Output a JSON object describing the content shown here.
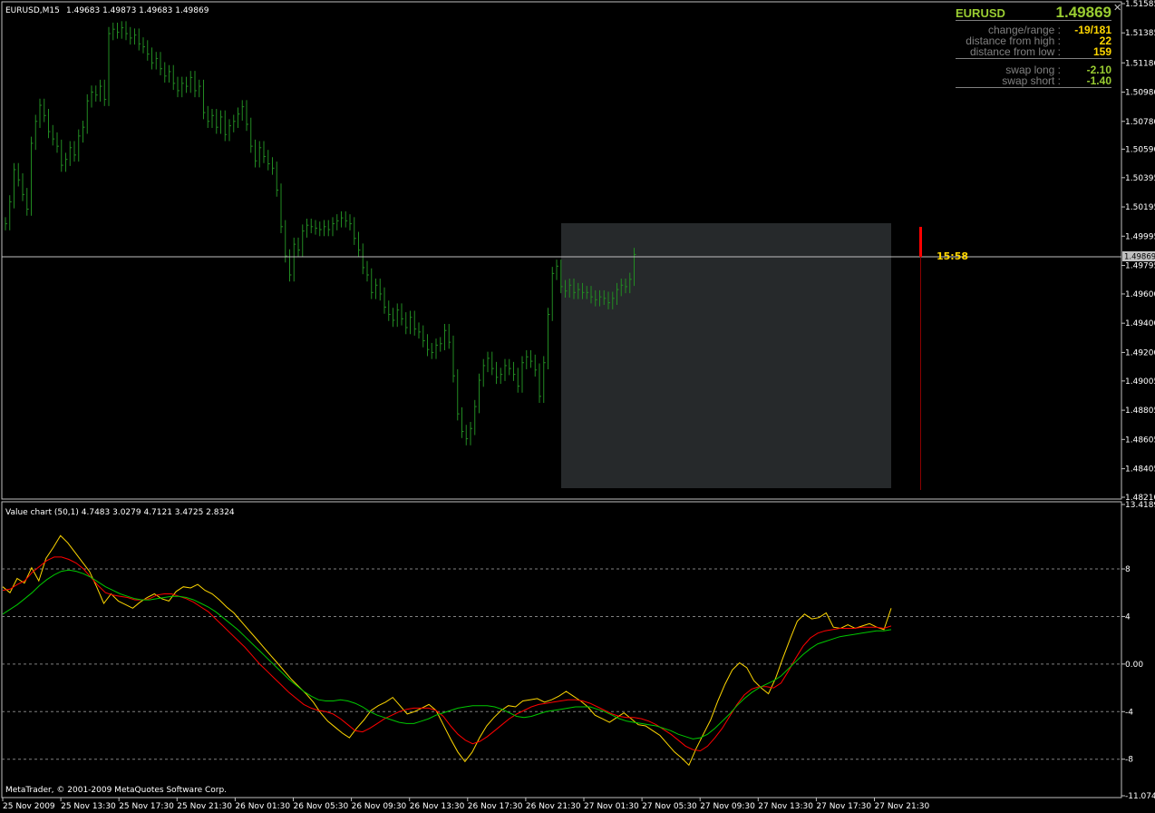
{
  "header": {
    "symbol_timeframe": "EURUSD,M15",
    "ohlc": "1.49683 1.49873 1.49683 1.49869"
  },
  "info_panel": {
    "symbol": "EURUSD",
    "price": "1.49869",
    "rows": [
      {
        "label": "change/range :",
        "value": "-19/181",
        "color": "#ffd700"
      },
      {
        "label": "distance from high :",
        "value": "22",
        "color": "#ffd700"
      },
      {
        "label": "distance from low :",
        "value": "159",
        "color": "#ffd700"
      },
      {
        "label": "swap long :",
        "value": "-2.10",
        "color": "#9acd32"
      },
      {
        "label": "swap short :",
        "value": "-1.40",
        "color": "#9acd32"
      }
    ]
  },
  "timer": "15:58",
  "indicator": {
    "title": "Value chart (50,1) 4.7483 3.0279 4.7121 3.4725 2.8324"
  },
  "copyright": "MetaTrader, © 2001-2009 MetaQuotes Software Corp.",
  "price_axis": {
    "labels": [
      "1.51585",
      "1.51385",
      "1.51180",
      "1.50980",
      "1.50780",
      "1.50590",
      "1.50395",
      "1.50195",
      "1.49995",
      "1.49869",
      "1.49795",
      "1.49600",
      "1.49400",
      "1.49200",
      "1.49005",
      "1.48805",
      "1.48605",
      "1.48405",
      "1.48210"
    ],
    "current": "1.49869"
  },
  "indicator_axis": {
    "labels": [
      "13.4189",
      "8",
      "4",
      "0.00",
      "-4",
      "-8",
      "-11.0748"
    ]
  },
  "time_axis": {
    "labels": [
      "25 Nov 2009",
      "25 Nov 13:30",
      "25 Nov 17:30",
      "25 Nov 21:30",
      "26 Nov 01:30",
      "26 Nov 05:30",
      "26 Nov 09:30",
      "26 Nov 13:30",
      "26 Nov 17:30",
      "26 Nov 21:30",
      "27 Nov 01:30",
      "27 Nov 05:30",
      "27 Nov 09:30",
      "27 Nov 13:30",
      "27 Nov 17:30",
      "27 Nov 21:30"
    ]
  },
  "colors": {
    "bars": "#228b22",
    "value_line": "#ffd700",
    "ma_fast": "#ff0000",
    "ma_slow": "#00c800",
    "grid": "#808080",
    "shade": "#26292b",
    "current_line": "#c0c0c0",
    "timer": "#ffd700",
    "marker": "#ff0000"
  },
  "chart_data": {
    "type": "line",
    "price": {
      "ylim": [
        1.4821,
        1.51585
      ],
      "current": 1.49869,
      "close": [
        1.5008,
        1.5023,
        1.5045,
        1.5038,
        1.5028,
        1.5018,
        1.5063,
        1.5078,
        1.5089,
        1.5082,
        1.5071,
        1.5066,
        1.5061,
        1.5048,
        1.5052,
        1.506,
        1.5055,
        1.5068,
        1.5074,
        1.5092,
        1.5098,
        1.5096,
        1.5102,
        1.5093,
        1.5138,
        1.5141,
        1.5139,
        1.5142,
        1.5138,
        1.5135,
        1.5137,
        1.5131,
        1.5129,
        1.5124,
        1.5118,
        1.5121,
        1.5114,
        1.5109,
        1.5112,
        1.5104,
        1.5099,
        1.5104,
        1.5102,
        1.5108,
        1.5099,
        1.5102,
        1.5084,
        1.5078,
        1.5082,
        1.5074,
        1.5081,
        1.5069,
        1.5075,
        1.5078,
        1.5083,
        1.5088,
        1.5076,
        1.5061,
        1.5051,
        1.506,
        1.5054,
        1.5049,
        1.5046,
        1.5031,
        1.5006,
        1.4986,
        1.4973,
        1.4994,
        1.499,
        1.5003,
        1.5007,
        1.5006,
        1.5005,
        1.5004,
        1.5006,
        1.5004,
        1.5008,
        1.501,
        1.5012,
        1.501,
        1.5008,
        1.4998,
        1.499,
        1.4978,
        1.4973,
        1.4961,
        1.4966,
        1.496,
        1.4951,
        1.4946,
        1.4942,
        1.4949,
        1.4943,
        1.4937,
        1.4944,
        1.4936,
        1.4934,
        1.4928,
        1.4922,
        1.492,
        1.4925,
        1.4926,
        1.4935,
        1.4927,
        1.4904,
        1.4878,
        1.4866,
        1.4861,
        1.4868,
        1.4883,
        1.4901,
        1.4911,
        1.4916,
        1.4909,
        1.4903,
        1.4905,
        1.4911,
        1.4909,
        1.4905,
        1.4897,
        1.4913,
        1.4917,
        1.4914,
        1.4908,
        1.489,
        1.4913,
        1.4946,
        1.4974,
        1.4979,
        1.4965,
        1.4962,
        1.4966,
        1.4961,
        1.4963,
        1.4961,
        1.4961,
        1.4958,
        1.4956,
        1.4958,
        1.4957,
        1.4954,
        1.4957,
        1.4963,
        1.4966,
        1.4965,
        1.497,
        1.4987
      ]
    },
    "indicator": {
      "ylim": [
        -11.0748,
        13.4189
      ],
      "series": [
        {
          "values": [
            6.5,
            6.0,
            7.2,
            6.8,
            8.1,
            7.0,
            8.9,
            9.8,
            10.8,
            10.2,
            9.4,
            8.6,
            7.8,
            6.5,
            5.1,
            5.9,
            5.3,
            5.0,
            4.7,
            5.2,
            5.6,
            5.9,
            5.5,
            5.3,
            6.1,
            6.5,
            6.4,
            6.7,
            6.2,
            5.9,
            5.4,
            4.8,
            4.3,
            3.6,
            2.9,
            2.2,
            1.5,
            0.8,
            0.1,
            -0.6,
            -1.3,
            -1.9,
            -2.5,
            -3.2,
            -4.1,
            -4.8,
            -5.3,
            -5.8,
            -6.2,
            -5.4,
            -4.7,
            -3.9,
            -3.5,
            -3.2,
            -2.8,
            -3.5,
            -4.2,
            -4.0,
            -3.7,
            -3.4,
            -3.9,
            -5.1,
            -6.3,
            -7.4,
            -8.2,
            -7.4,
            -6.2,
            -5.2,
            -4.5,
            -3.9,
            -3.5,
            -3.6,
            -3.1,
            -3.0,
            -2.9,
            -3.2,
            -3.0,
            -2.7,
            -2.3,
            -2.7,
            -3.1,
            -3.6,
            -4.3,
            -4.6,
            -4.9,
            -4.5,
            -4.1,
            -4.6,
            -5.1,
            -5.2,
            -5.6,
            -6.0,
            -6.7,
            -7.4,
            -7.9,
            -8.5,
            -7.1,
            -5.9,
            -4.7,
            -3.1,
            -1.7,
            -0.5,
            0.1,
            -0.3,
            -1.4,
            -2.0,
            -2.5,
            -1.2,
            0.5,
            2.1,
            3.6,
            4.2,
            3.8,
            3.9,
            4.3,
            3.1,
            3.0,
            3.3,
            3.0,
            3.2,
            3.4,
            3.1,
            2.9,
            4.7
          ]
        },
        {
          "values": [
            6.2,
            6.3,
            6.7,
            7.0,
            7.7,
            8.2,
            8.7,
            9.0,
            9.0,
            8.8,
            8.5,
            8.0,
            7.3,
            6.6,
            6.0,
            5.8,
            5.7,
            5.6,
            5.4,
            5.4,
            5.5,
            5.8,
            5.9,
            5.9,
            5.7,
            5.5,
            5.2,
            4.8,
            4.4,
            3.8,
            3.2,
            2.6,
            2.0,
            1.4,
            0.7,
            0.0,
            -0.6,
            -1.2,
            -1.8,
            -2.4,
            -2.9,
            -3.4,
            -3.7,
            -3.9,
            -4.0,
            -4.2,
            -4.6,
            -5.1,
            -5.6,
            -5.7,
            -5.4,
            -5.0,
            -4.6,
            -4.3,
            -4.0,
            -3.8,
            -3.7,
            -3.7,
            -3.7,
            -3.9,
            -4.4,
            -5.2,
            -5.9,
            -6.4,
            -6.7,
            -6.5,
            -6.1,
            -5.6,
            -5.1,
            -4.6,
            -4.2,
            -3.9,
            -3.6,
            -3.4,
            -3.3,
            -3.2,
            -3.1,
            -3.0,
            -3.0,
            -3.1,
            -3.3,
            -3.6,
            -3.9,
            -4.2,
            -4.4,
            -4.5,
            -4.5,
            -4.6,
            -4.8,
            -5.1,
            -5.5,
            -5.9,
            -6.4,
            -6.9,
            -7.2,
            -7.3,
            -6.9,
            -6.2,
            -5.4,
            -4.4,
            -3.4,
            -2.6,
            -2.1,
            -1.9,
            -1.9,
            -2.0,
            -1.6,
            -0.6,
            0.5,
            1.5,
            2.2,
            2.6,
            2.8,
            2.9,
            3.0,
            3.0,
            3.0,
            3.1,
            3.1,
            3.1,
            3.0,
            3.2
          ]
        },
        {
          "values": [
            4.2,
            4.6,
            5.0,
            5.5,
            6.0,
            6.6,
            7.1,
            7.5,
            7.8,
            7.9,
            7.8,
            7.6,
            7.3,
            6.9,
            6.5,
            6.2,
            5.9,
            5.7,
            5.5,
            5.4,
            5.4,
            5.5,
            5.6,
            5.7,
            5.7,
            5.6,
            5.4,
            5.1,
            4.8,
            4.4,
            3.9,
            3.4,
            2.9,
            2.3,
            1.7,
            1.1,
            0.5,
            -0.1,
            -0.7,
            -1.3,
            -1.8,
            -2.3,
            -2.7,
            -3.0,
            -3.1,
            -3.1,
            -3.0,
            -3.1,
            -3.3,
            -3.6,
            -4.0,
            -4.3,
            -4.5,
            -4.7,
            -4.9,
            -5.0,
            -5.0,
            -4.8,
            -4.6,
            -4.3,
            -4.1,
            -3.9,
            -3.7,
            -3.6,
            -3.5,
            -3.5,
            -3.5,
            -3.6,
            -3.8,
            -4.1,
            -4.4,
            -4.5,
            -4.4,
            -4.2,
            -4.0,
            -3.9,
            -3.8,
            -3.7,
            -3.6,
            -3.6,
            -3.6,
            -3.8,
            -4.0,
            -4.3,
            -4.6,
            -4.8,
            -4.9,
            -5.0,
            -5.1,
            -5.2,
            -5.4,
            -5.6,
            -5.9,
            -6.1,
            -6.3,
            -6.2,
            -5.9,
            -5.4,
            -4.8,
            -4.2,
            -3.5,
            -2.9,
            -2.4,
            -2.0,
            -1.7,
            -1.4,
            -1.0,
            -0.4,
            0.2,
            0.8,
            1.3,
            1.7,
            1.9,
            2.1,
            2.3,
            2.4,
            2.5,
            2.6,
            2.7,
            2.8,
            2.8,
            2.9
          ]
        }
      ]
    }
  }
}
